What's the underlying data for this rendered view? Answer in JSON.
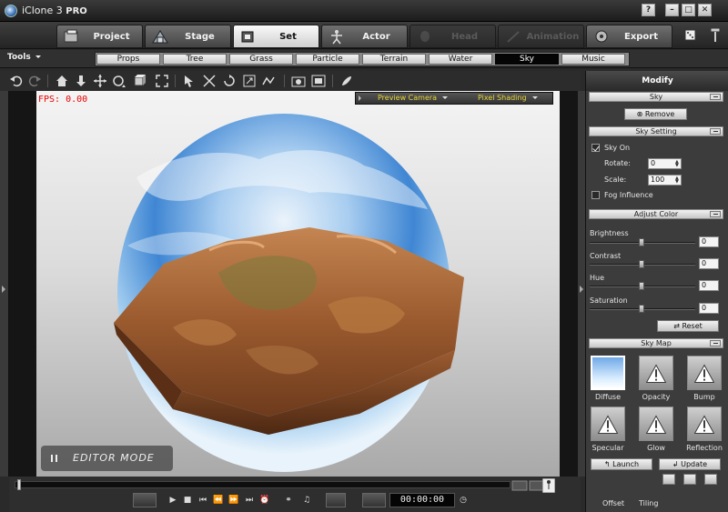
{
  "app": {
    "title": "iClone 3",
    "edition": "PRO",
    "window_buttons": [
      "?",
      "–",
      "□",
      "✕"
    ]
  },
  "main_tabs": [
    {
      "label": "Project",
      "icon": "project-icon",
      "state": "normal"
    },
    {
      "label": "Stage",
      "icon": "stage-icon",
      "state": "normal"
    },
    {
      "label": "Set",
      "icon": "set-icon",
      "state": "active"
    },
    {
      "label": "Actor",
      "icon": "actor-icon",
      "state": "normal"
    },
    {
      "label": "Head",
      "icon": "head-icon",
      "state": "disabled"
    },
    {
      "label": "Animation",
      "icon": "animation-icon",
      "state": "disabled"
    },
    {
      "label": "Export",
      "icon": "export-icon",
      "state": "normal"
    }
  ],
  "tools_menu": {
    "label": "Tools"
  },
  "sub_tabs": [
    {
      "label": "Props",
      "active": false
    },
    {
      "label": "Tree",
      "active": false
    },
    {
      "label": "Grass",
      "active": false
    },
    {
      "label": "Particle",
      "active": false
    },
    {
      "label": "Terrain",
      "active": false
    },
    {
      "label": "Water",
      "active": false
    },
    {
      "label": "Sky",
      "active": true
    },
    {
      "label": "Music",
      "active": false
    }
  ],
  "viewport": {
    "fps": "FPS: 0.00",
    "camera": "Preview Camera",
    "shading": "Pixel Shading",
    "mode": "EDITOR MODE"
  },
  "timeline": {
    "time": "00:00:00"
  },
  "panel": {
    "title": "Modify",
    "sky_section": {
      "header": "Sky",
      "remove_label": "Remove"
    },
    "sky_setting": {
      "header": "Sky Setting",
      "sky_on_label": "Sky On",
      "sky_on": true,
      "rotate_label": "Rotate:",
      "rotate_value": "0",
      "scale_label": "Scale:",
      "scale_value": "100",
      "fog_label": "Fog Influence",
      "fog_on": false
    },
    "adjust_color": {
      "header": "Adjust Color",
      "sliders": [
        {
          "label": "Brightness",
          "value": "0",
          "level": 0.5
        },
        {
          "label": "Contrast",
          "value": "0",
          "level": 0.5
        },
        {
          "label": "Hue",
          "value": "0",
          "level": 0.5
        },
        {
          "label": "Saturation",
          "value": "0",
          "level": 0.5
        }
      ],
      "reset_label": "Reset"
    },
    "sky_map": {
      "header": "Sky Map",
      "maps": [
        {
          "label": "Diffuse",
          "selected": true
        },
        {
          "label": "Opacity",
          "selected": false
        },
        {
          "label": "Bump",
          "selected": false
        },
        {
          "label": "Specular",
          "selected": false
        },
        {
          "label": "Glow",
          "selected": false
        },
        {
          "label": "Reflection",
          "selected": false
        }
      ],
      "launch_label": "Launch",
      "update_label": "Update",
      "offset_label": "Offset",
      "tiling_label": "Tiling"
    }
  },
  "colors": {
    "accent_blue": "#4a86d0",
    "fps_red": "#ee0000",
    "viewport_label_yellow": "#e8d63a"
  }
}
